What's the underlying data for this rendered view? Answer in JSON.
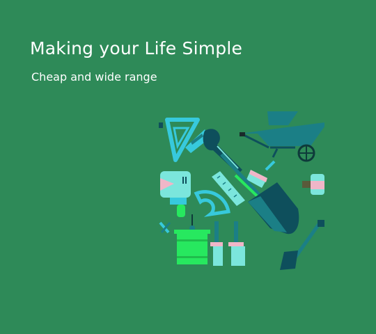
{
  "hero": {
    "title": "Making your Life Simple",
    "subtitle": "Cheap and wide range"
  },
  "illustration": {
    "icons": [
      "set-square-icon",
      "wheelbarrow-icon",
      "saw-icon",
      "shovel-icon",
      "paint-roller-icon",
      "drill-icon",
      "protractor-icon",
      "ruler-icon",
      "paint-bucket-icon",
      "paintbrush-icon",
      "tube-icon",
      "trowel-icon"
    ]
  },
  "colors": {
    "background": "#2e8a58",
    "text": "#ffffff",
    "teal": "#1b7f86",
    "dark_teal": "#0e4f5c",
    "cyan": "#37c9dc",
    "mint": "#7be6dc",
    "green": "#27e85f",
    "pink": "#f0b6c8"
  }
}
